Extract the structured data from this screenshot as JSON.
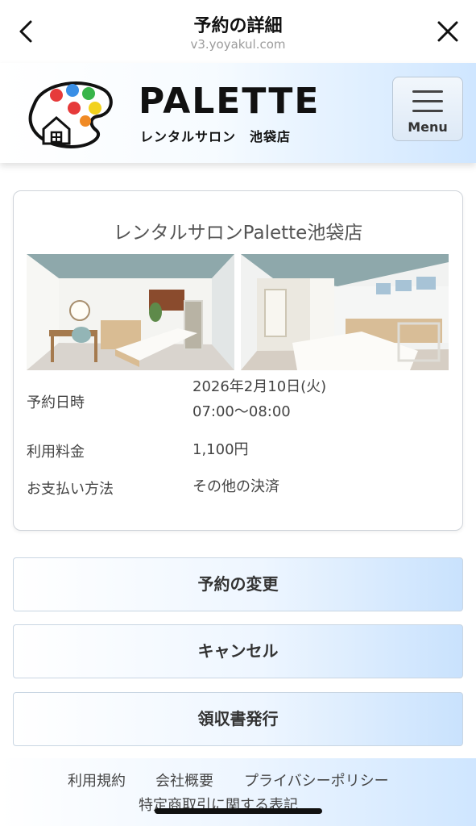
{
  "navbar": {
    "title": "予約の詳細",
    "url": "v3.yoyakul.com",
    "back_icon": "chevron-left-icon",
    "close_icon": "close-icon"
  },
  "header": {
    "logo_name": "PALETTE",
    "logo_sub": "レンタルサロン　池袋店",
    "menu_label": "Menu"
  },
  "reservation": {
    "title": "レンタルサロンPalette池袋店",
    "date_label": "予約日時",
    "date_value": "2026年2月10日(火)",
    "time_value": "07:00〜08:00",
    "fee_label": "利用料金",
    "fee_value": "1,100円",
    "payment_label": "お支払い方法",
    "payment_value": "その他の決済"
  },
  "actions": {
    "change_label": "予約の変更",
    "cancel_label": "キャンセル",
    "receipt_label": "領収書発行"
  },
  "footer": {
    "terms": "利用規約",
    "company": "会社概要",
    "privacy": "プライバシーポリシー",
    "commerce": "特定商取引に関する表記"
  },
  "colors": {
    "accent_blue": "#c9e2fd",
    "text": "#333333",
    "url_gray": "#9b9b9b"
  }
}
